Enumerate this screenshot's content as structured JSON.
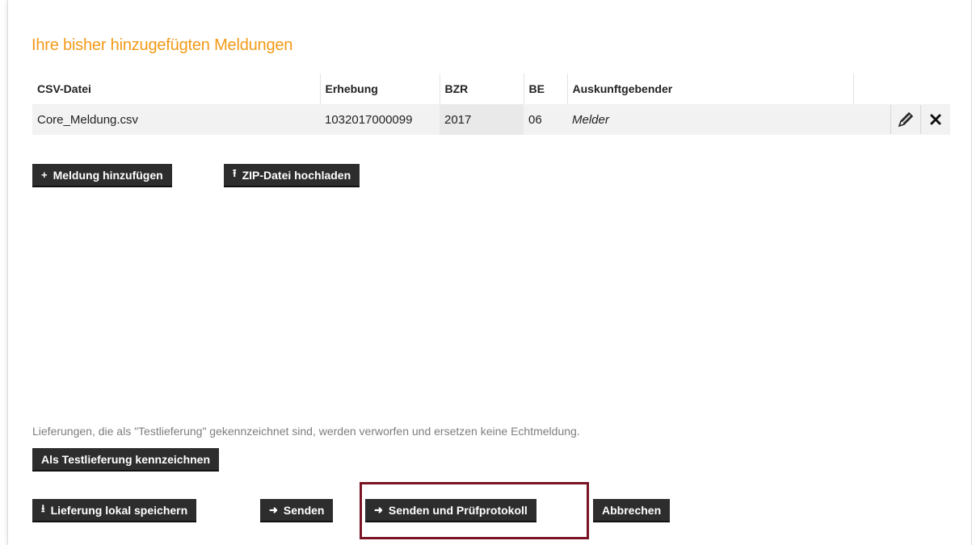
{
  "section": {
    "title": "Ihre bisher hinzugefügten Meldungen"
  },
  "table": {
    "headers": [
      "CSV-Datei",
      "Erhebung",
      "BZR",
      "BE",
      "Auskunftgebender"
    ],
    "rows": [
      {
        "csv": "Core_Meldung.csv",
        "erhebung": "1032017000099",
        "bzr": "2017",
        "be": "06",
        "auskunftgebender": "Melder"
      }
    ],
    "edit_icon": "pencil-icon",
    "delete_icon": "close-icon"
  },
  "buttons": {
    "add_report": {
      "icon": "+",
      "label": "Meldung hinzufügen"
    },
    "upload_zip": {
      "icon": "⭱",
      "label": "ZIP-Datei hochladen"
    },
    "mark_test": {
      "label": "Als Testlieferung kennzeichnen"
    },
    "save_local": {
      "icon": "⭳",
      "label": "Lieferung lokal speichern"
    },
    "send": {
      "icon": "➜",
      "label": "Senden"
    },
    "send_protocol": {
      "icon": "➜",
      "label": "Senden und Prüfprotokoll"
    },
    "cancel": {
      "label": "Abbrechen"
    }
  },
  "hint_text": "Lieferungen, die als \"Testlieferung\" gekennzeichnet sind, werden verworfen und ersetzen keine Echtmeldung.",
  "colors": {
    "accent": "#f39a18",
    "button_bg": "#2d2d2d",
    "highlight": "#7a1424"
  }
}
